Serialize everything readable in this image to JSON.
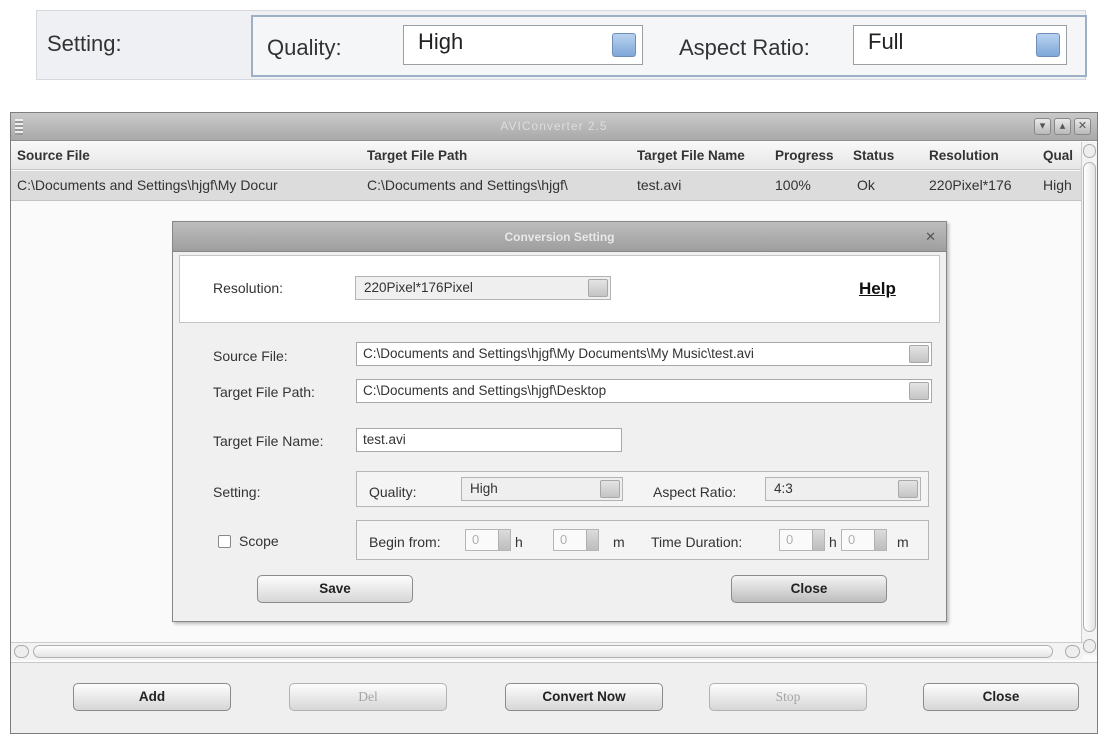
{
  "top_strip": {
    "setting_label": "Setting:",
    "quality_label": "Quality:",
    "quality_value": "High",
    "aspect_label": "Aspect Ratio:",
    "aspect_value": "Full"
  },
  "main_window": {
    "title": "AVIConverter 2.5",
    "columns": [
      "Source File",
      "Target File Path",
      "Target File Name",
      "Progress",
      "Status",
      "Resolution",
      "Qual"
    ],
    "rows": [
      {
        "source": "C:\\Documents and Settings\\hjgf\\My Docur",
        "target_path": "C:\\Documents and Settings\\hjgf\\",
        "target_name": "test.avi",
        "progress": "100%",
        "status": "Ok",
        "resolution": "220Pixel*176",
        "quality": "High"
      }
    ],
    "buttons": {
      "add": "Add",
      "del": "Del",
      "convert": "Convert Now",
      "stop": "Stop",
      "close": "Close"
    }
  },
  "dialog": {
    "title": "Conversion Setting",
    "resolution_label": "Resolution:",
    "resolution_value": "220Pixel*176Pixel",
    "help": "Help",
    "source_label": "Source File:",
    "source_value": "C:\\Documents and Settings\\hjgf\\My Documents\\My Music\\test.avi",
    "target_path_label": "Target File Path:",
    "target_path_value": "C:\\Documents and Settings\\hjgf\\Desktop",
    "target_name_label": "Target File Name:",
    "target_name_value": "test.avi",
    "setting_label": "Setting:",
    "quality_label": "Quality:",
    "quality_value": "High",
    "aspect_label": "Aspect Ratio:",
    "aspect_value": "4:3",
    "scope_label": "Scope",
    "begin_label": "Begin from:",
    "begin_h": "0",
    "begin_m": "0",
    "h_unit": "h",
    "m_unit": "m",
    "duration_label": "Time Duration:",
    "dur_h": "0",
    "dur_m": "0",
    "save": "Save",
    "close": "Close"
  }
}
